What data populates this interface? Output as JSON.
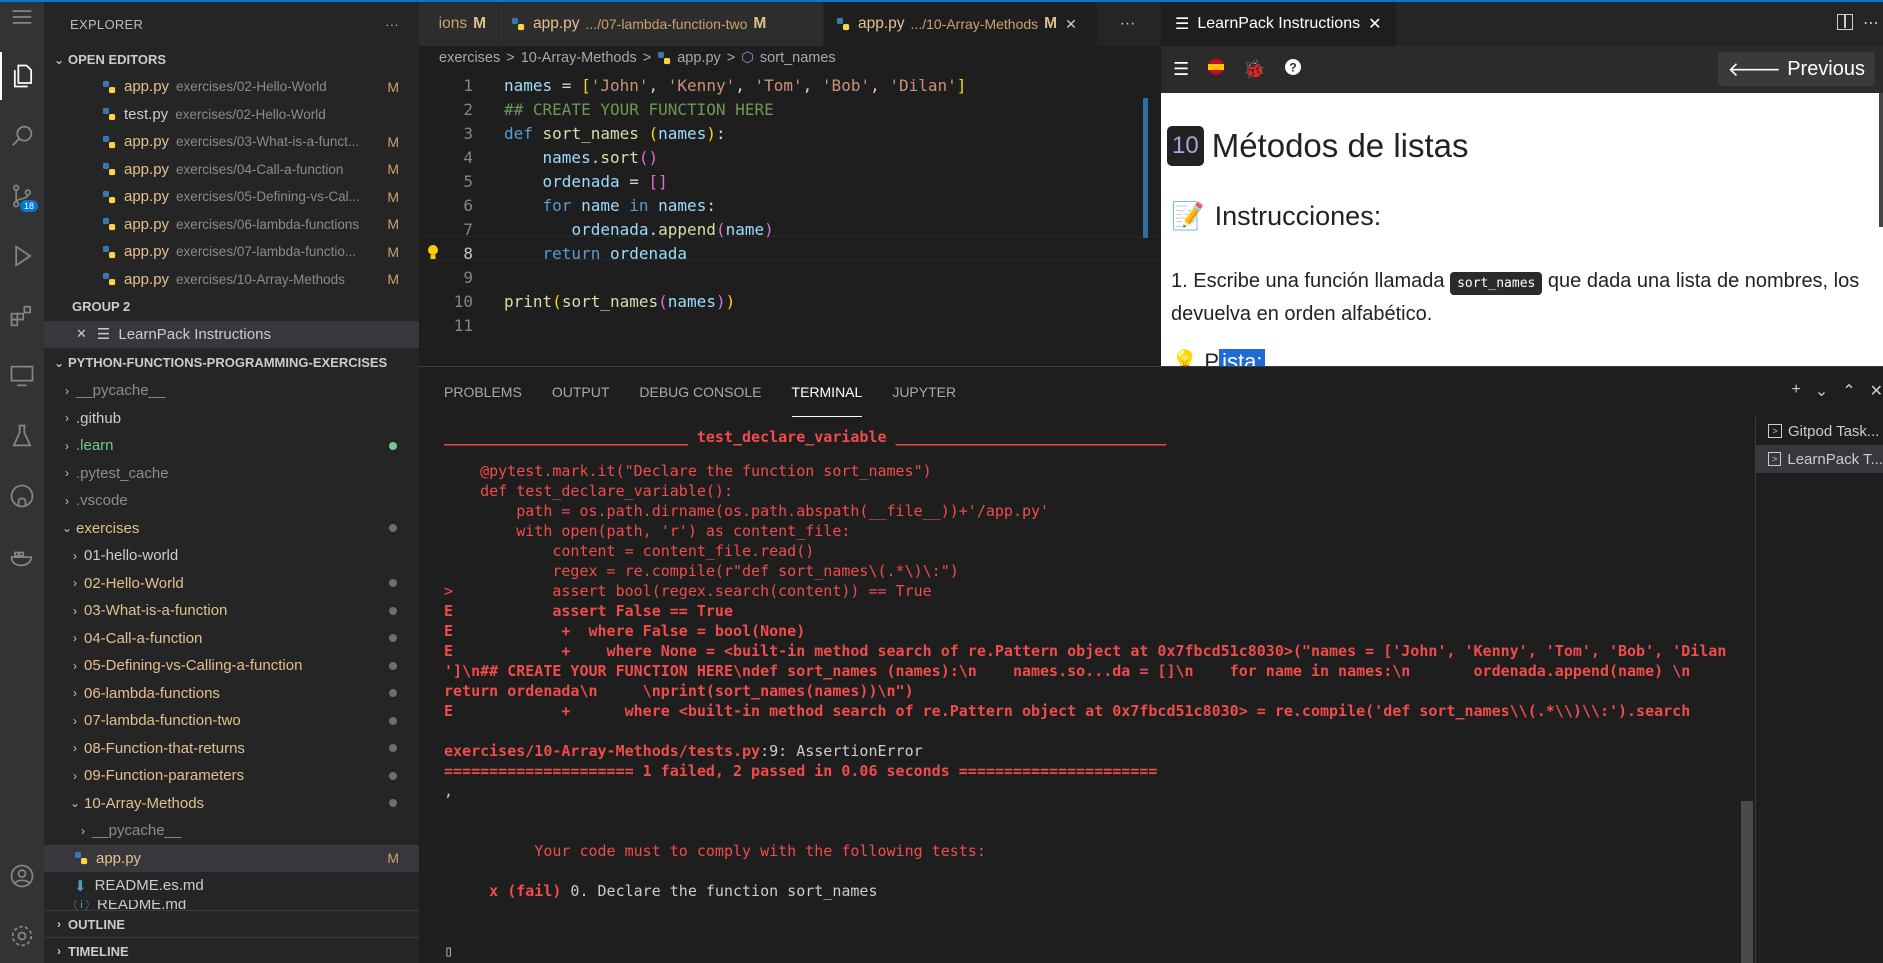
{
  "explorer": {
    "title": "EXPLORER",
    "more": "···",
    "open_editors_label": "OPEN EDITORS",
    "open_editors": [
      {
        "name": "app.py",
        "path": "exercises/02-Hello-World",
        "mod": "M"
      },
      {
        "name": "test.py",
        "path": "exercises/02-Hello-World",
        "mod": ""
      },
      {
        "name": "app.py",
        "path": "exercises/03-What-is-a-funct...",
        "mod": "M"
      },
      {
        "name": "app.py",
        "path": "exercises/04-Call-a-function",
        "mod": "M"
      },
      {
        "name": "app.py",
        "path": "exercises/05-Defining-vs-Cal...",
        "mod": "M"
      },
      {
        "name": "app.py",
        "path": "exercises/06-lambda-functions",
        "mod": "M"
      },
      {
        "name": "app.py",
        "path": "exercises/07-lambda-functio...",
        "mod": "M"
      },
      {
        "name": "app.py",
        "path": "exercises/10-Array-Methods",
        "mod": "M"
      }
    ],
    "group2_label": "GROUP 2",
    "group2_item": "LearnPack Instructions",
    "workspace_label": "PYTHON-FUNCTIONS-PROGRAMMING-EXERCISES",
    "root_items": [
      "__pycache__",
      ".github",
      ".learn",
      ".pytest_cache",
      ".vscode",
      "exercises"
    ],
    "exercise_folders": [
      "01-hello-world",
      "02-Hello-World",
      "03-What-is-a-function",
      "04-Call-a-function",
      "05-Defining-vs-Calling-a-function",
      "06-lambda-functions",
      "07-lambda-function-two",
      "08-Function-that-returns",
      "09-Function-parameters",
      "10-Array-Methods"
    ],
    "array_children": [
      "__pycache__",
      "app.py",
      "README.es.md",
      "README.md"
    ],
    "app_mod": "M",
    "outline_label": "OUTLINE",
    "timeline_label": "TIMELINE"
  },
  "activity": {
    "scm_badge": "18"
  },
  "tabs": [
    {
      "label": "ions",
      "desc": "",
      "mod": "M"
    },
    {
      "label": "app.py",
      "desc": ".../07-lambda-function-two",
      "mod": "M"
    },
    {
      "label": "app.py",
      "desc": ".../10-Array-Methods",
      "mod": "M"
    }
  ],
  "tab_close": "✕",
  "tab_more": "···",
  "breadcrumb": {
    "folder1": "exercises",
    "folder2": "10-Array-Methods",
    "file": "app.py",
    "symbol": "sort_names",
    "sep": ">"
  },
  "learnpack": {
    "tab_label": "LearnPack Instructions",
    "tab_close": "✕",
    "prev_label": "Previous",
    "prev_arrow": "🡐",
    "number": "10",
    "title": "Métodos de listas",
    "instructions_icon": "📝",
    "instructions_heading": "Instrucciones:",
    "item_number": "1.",
    "item_text_1": "Escribe una función llamada",
    "item_code": "sort_names",
    "item_text_2": "que dada una lista de nombres, los devuelva en orden alfabético.",
    "hint_icon": "💡",
    "hint_first": "P",
    "hint_rest": "ista:"
  },
  "panel": {
    "tabs": [
      "PROBLEMS",
      "OUTPUT",
      "DEBUG CONSOLE",
      "TERMINAL",
      "JUPYTER"
    ],
    "add": "+",
    "terminals": [
      "Gitpod Task...",
      "LearnPack T..."
    ]
  },
  "terminal": {
    "header": "___________________________ test_declare_variable ______________________________",
    "l1": "    @pytest.mark.it(\"Declare the function sort_names\")",
    "l2": "    def test_declare_variable():",
    "l3": "        path = os.path.dirname(os.path.abspath(__file__))+'/app.py'",
    "l4": "        with open(path, 'r') as content_file:",
    "l5": "            content = content_file.read()",
    "l6": "            regex = re.compile(r\"def sort_names\\(.*\\)\\:\")",
    "l7": ">           assert bool(regex.search(content)) == True",
    "e1": "E           assert False == True",
    "e2": "E            +  where False = bool(None)",
    "e3": "E            +    where None = <built-in method search of re.Pattern object at 0x7fbcd51c8030>(\"names = ['John', 'Kenny', 'Tom', 'Bob', 'Dilan",
    "e4": "']\\n## CREATE YOUR FUNCTION HERE\\ndef sort_names (names):\\n    names.so...da = []\\n    for name in names:\\n       ordenada.append(name) \\n",
    "e5": "return ordenada\\n     \\nprint(sort_names(names))\\n\")",
    "e6": "E            +      where <built-in method search of re.Pattern object at 0x7fbcd51c8030> = re.compile('def sort_names\\\\(.*\\\\)\\\\:').search",
    "loc_path": "exercises/10-Array-Methods/tests.py",
    "loc_rest": ":9: AssertionError",
    "summary": "===================== 1 failed, 2 passed in 0.06 seconds ======================",
    "comma": ",",
    "must_comply": "          Your code must to comply with the following tests:",
    "fail_mark": "     x (fail)",
    "fail_rest": " 0. Declare the function sort_names",
    "cursor": "▯"
  }
}
